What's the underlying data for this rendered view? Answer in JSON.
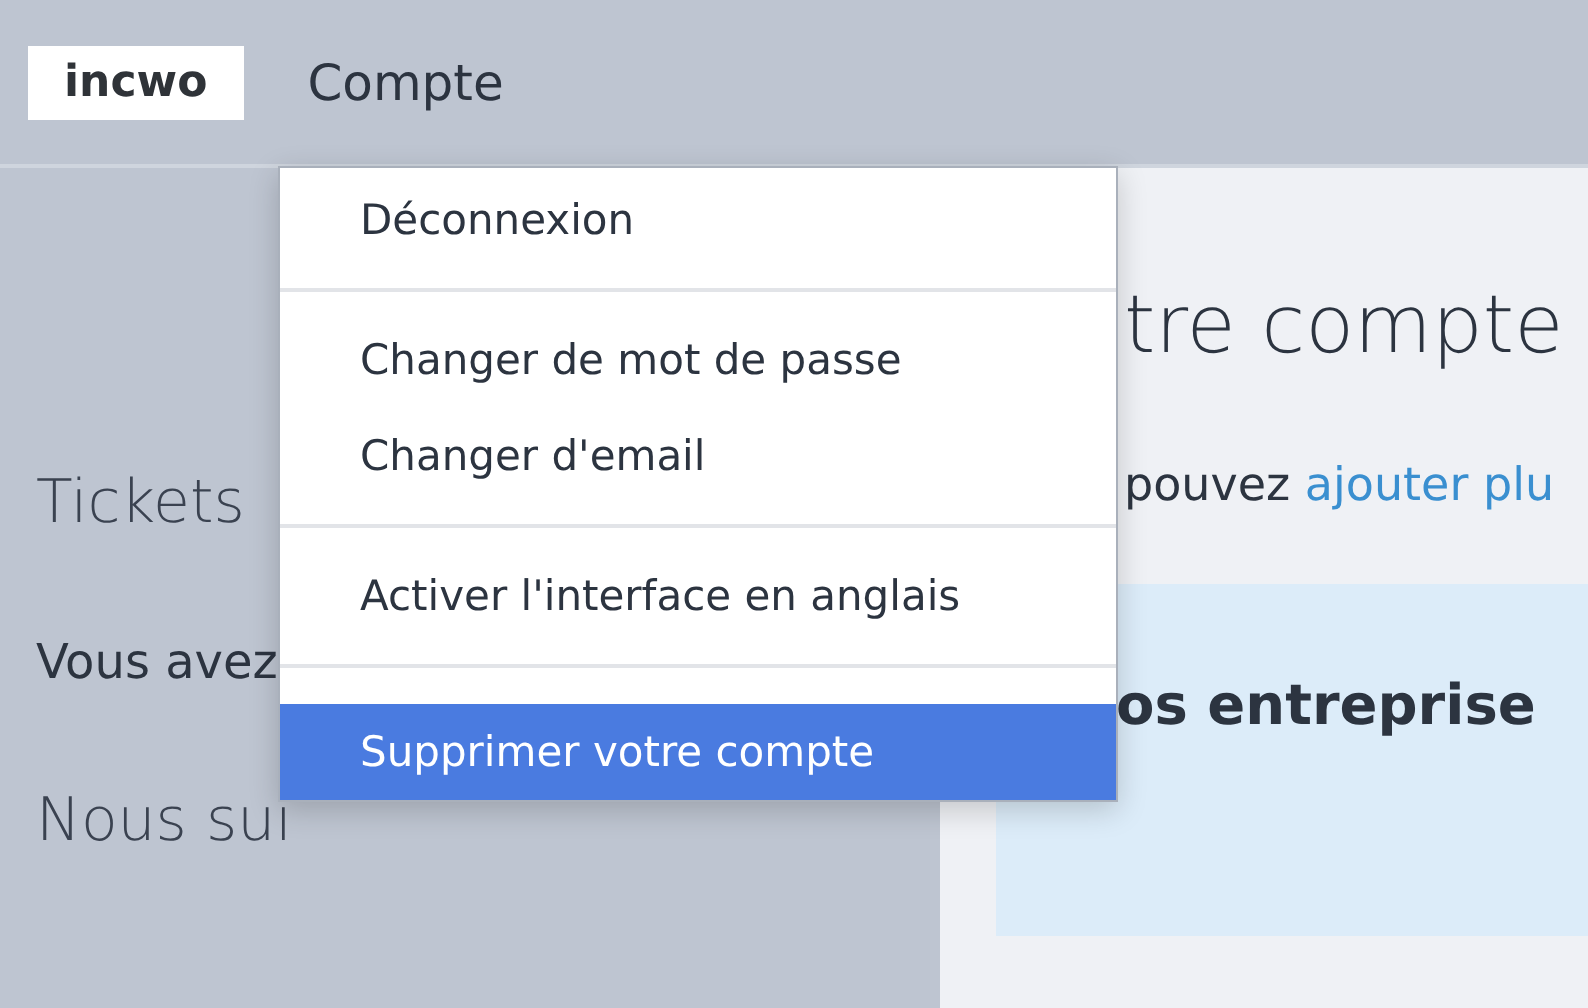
{
  "topbar": {
    "logo": "incwo",
    "menu_label": "Compte"
  },
  "account_menu": {
    "groups": [
      [
        {
          "label": "Déconnexion",
          "selected": false
        }
      ],
      [
        {
          "label": "Changer de mot de passe",
          "selected": false
        },
        {
          "label": "Changer d'email",
          "selected": false
        }
      ],
      [
        {
          "label": "Activer l'interface en anglais",
          "selected": false
        }
      ],
      [
        {
          "label": "Supprimer votre compte",
          "selected": true
        }
      ]
    ]
  },
  "left_panel": {
    "heading": "Tickets",
    "text": "Vous avez",
    "follow_heading": "Nous sui"
  },
  "main": {
    "title": "tre compte",
    "text": "pouvez",
    "link": "ajouter plu",
    "card_title": "os entreprise"
  }
}
